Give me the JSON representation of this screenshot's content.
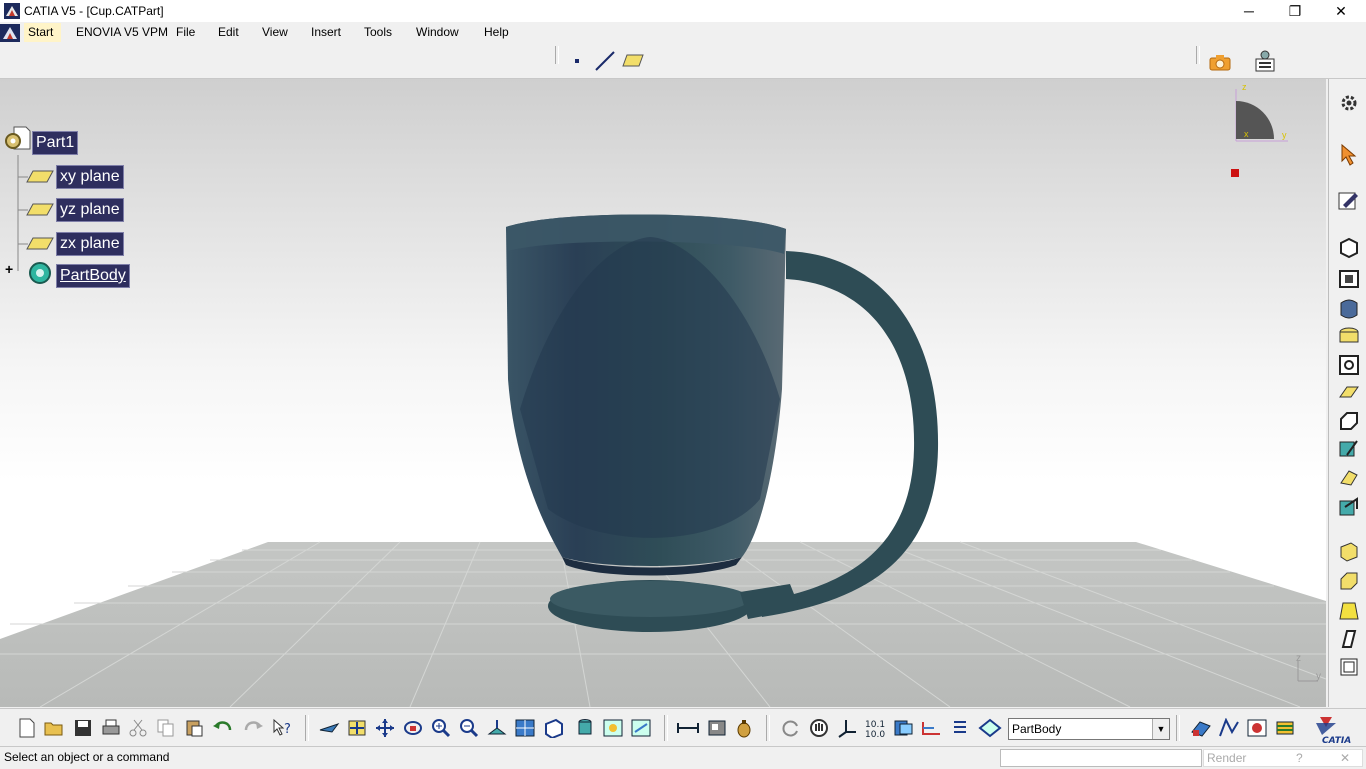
{
  "window": {
    "title": "CATIA V5 - [Cup.CATPart]",
    "minimize": "─",
    "maximize": "❐",
    "close": "✕",
    "mdi_minimize": "–",
    "mdi_restore": "❐",
    "mdi_close": "✕"
  },
  "menu": {
    "items": [
      "Start",
      "ENOVIA V5 VPM",
      "File",
      "Edit",
      "View",
      "Insert",
      "Tools",
      "Window",
      "Help"
    ]
  },
  "tree": {
    "root": "Part1",
    "children": [
      "xy plane",
      "yz plane",
      "zx plane",
      "PartBody"
    ],
    "expand": "+"
  },
  "compass": {
    "z_label": "z",
    "x_label": "x",
    "y_label": "y"
  },
  "axis_triad": {
    "z": "z",
    "y": "y"
  },
  "toolbar": {
    "body_selector_value": "PartBody",
    "dropdown_arrow": "▼"
  },
  "status": {
    "message": "Select an object or a command",
    "render_label": "Render",
    "help": "?",
    "close": "✕"
  },
  "colors": {
    "tree_bg": "#2e2e5e",
    "cup": "#2e4a55",
    "accent": "#fff4c8"
  }
}
